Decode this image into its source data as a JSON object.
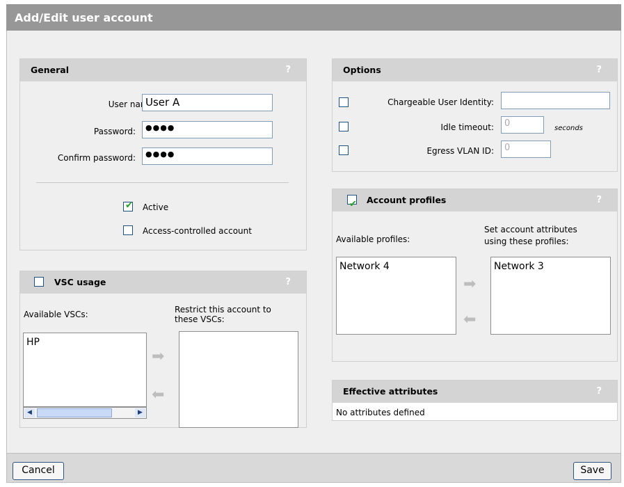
{
  "window": {
    "title": "Add/Edit user account"
  },
  "general": {
    "header": "General",
    "help": "?",
    "username_label": "User name:",
    "username_value": "User A",
    "password_label": "Password:",
    "password_value": "●●●●",
    "confirm_label": "Confirm password:",
    "confirm_value": "●●●●",
    "active_label": "Active",
    "active_checked": true,
    "access_label": "Access-controlled account",
    "access_checked": false
  },
  "vsc": {
    "header": "VSC usage",
    "help": "?",
    "checked": false,
    "available_label": "Available VSCs:",
    "restrict_label_line1": "Restrict this account to",
    "restrict_label_line2": "these VSCs:",
    "available_items": [
      "HP"
    ],
    "restricted_items": []
  },
  "options": {
    "header": "Options",
    "help": "?",
    "cui_label": "Chargeable User Identity:",
    "cui_value": "",
    "idle_label": "Idle timeout:",
    "idle_value": "0",
    "idle_unit": "seconds",
    "egress_label": "Egress VLAN ID:",
    "egress_value": "0"
  },
  "profiles": {
    "header": "Account profiles",
    "help": "?",
    "checked": true,
    "available_label": "Available profiles:",
    "set_label_line1": "Set account attributes",
    "set_label_line2": "using these profiles:",
    "available_items": [
      "Network 4"
    ],
    "selected_items": [
      "Network 3"
    ]
  },
  "effective": {
    "header": "Effective attributes",
    "help": "?",
    "text": "No attributes defined"
  },
  "footer": {
    "cancel_label": "Cancel",
    "save_label": "Save"
  },
  "colors": {
    "title_bar": "#979797",
    "panel_header": "#d4d4d4",
    "background": "#efefef",
    "check": "#21a121"
  },
  "icons": {
    "arrow_right": "➡",
    "arrow_left": "⬅",
    "scroll_left": "◀",
    "scroll_right": "▶",
    "check": "✔"
  }
}
